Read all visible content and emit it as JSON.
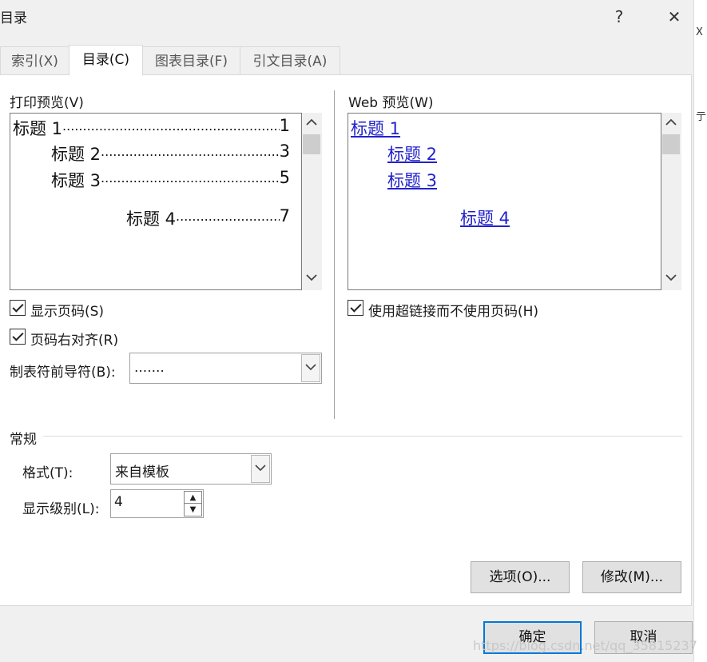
{
  "window": {
    "title": "目录",
    "help": "?",
    "close": "✕"
  },
  "tabs": [
    {
      "label": "索引(X)",
      "active": false
    },
    {
      "label": "目录(C)",
      "active": true
    },
    {
      "label": "图表目录(F)",
      "active": false
    },
    {
      "label": "引文目录(A)",
      "active": false
    }
  ],
  "print_preview": {
    "label": "打印预览(V)",
    "entries": [
      {
        "title": "标题 1",
        "page": "1"
      },
      {
        "title": "标题 2",
        "page": "3"
      },
      {
        "title": "标题 3",
        "page": "5"
      },
      {
        "title": "标题 4",
        "page": "7"
      }
    ]
  },
  "web_preview": {
    "label": "Web 预览(W)",
    "entries": [
      "标题 1",
      "标题 2",
      "标题 3",
      "标题 4"
    ]
  },
  "options": {
    "show_page_numbers": {
      "label": "显示页码(S)",
      "checked": true
    },
    "right_align": {
      "label": "页码右对齐(R)",
      "checked": true
    },
    "tab_leader": {
      "label": "制表符前导符(B):",
      "value": "......."
    },
    "use_hyperlinks": {
      "label": "使用超链接而不使用页码(H)",
      "checked": true
    }
  },
  "general": {
    "heading": "常规",
    "format": {
      "label": "格式(T):",
      "value": "来自模板"
    },
    "levels": {
      "label": "显示级别(L):",
      "value": "4"
    }
  },
  "buttons": {
    "options": "选项(O)...",
    "modify": "修改(M)...",
    "ok": "确定",
    "cancel": "取消"
  },
  "watermark": "https://blog.csdn.net/qq_35815237",
  "icons": {
    "scroll_up": "chevron-up-icon",
    "scroll_down": "chevron-down-icon",
    "dropdown": "chevron-down-icon",
    "spin_up": "triangle-up-icon",
    "spin_down": "triangle-down-icon"
  }
}
